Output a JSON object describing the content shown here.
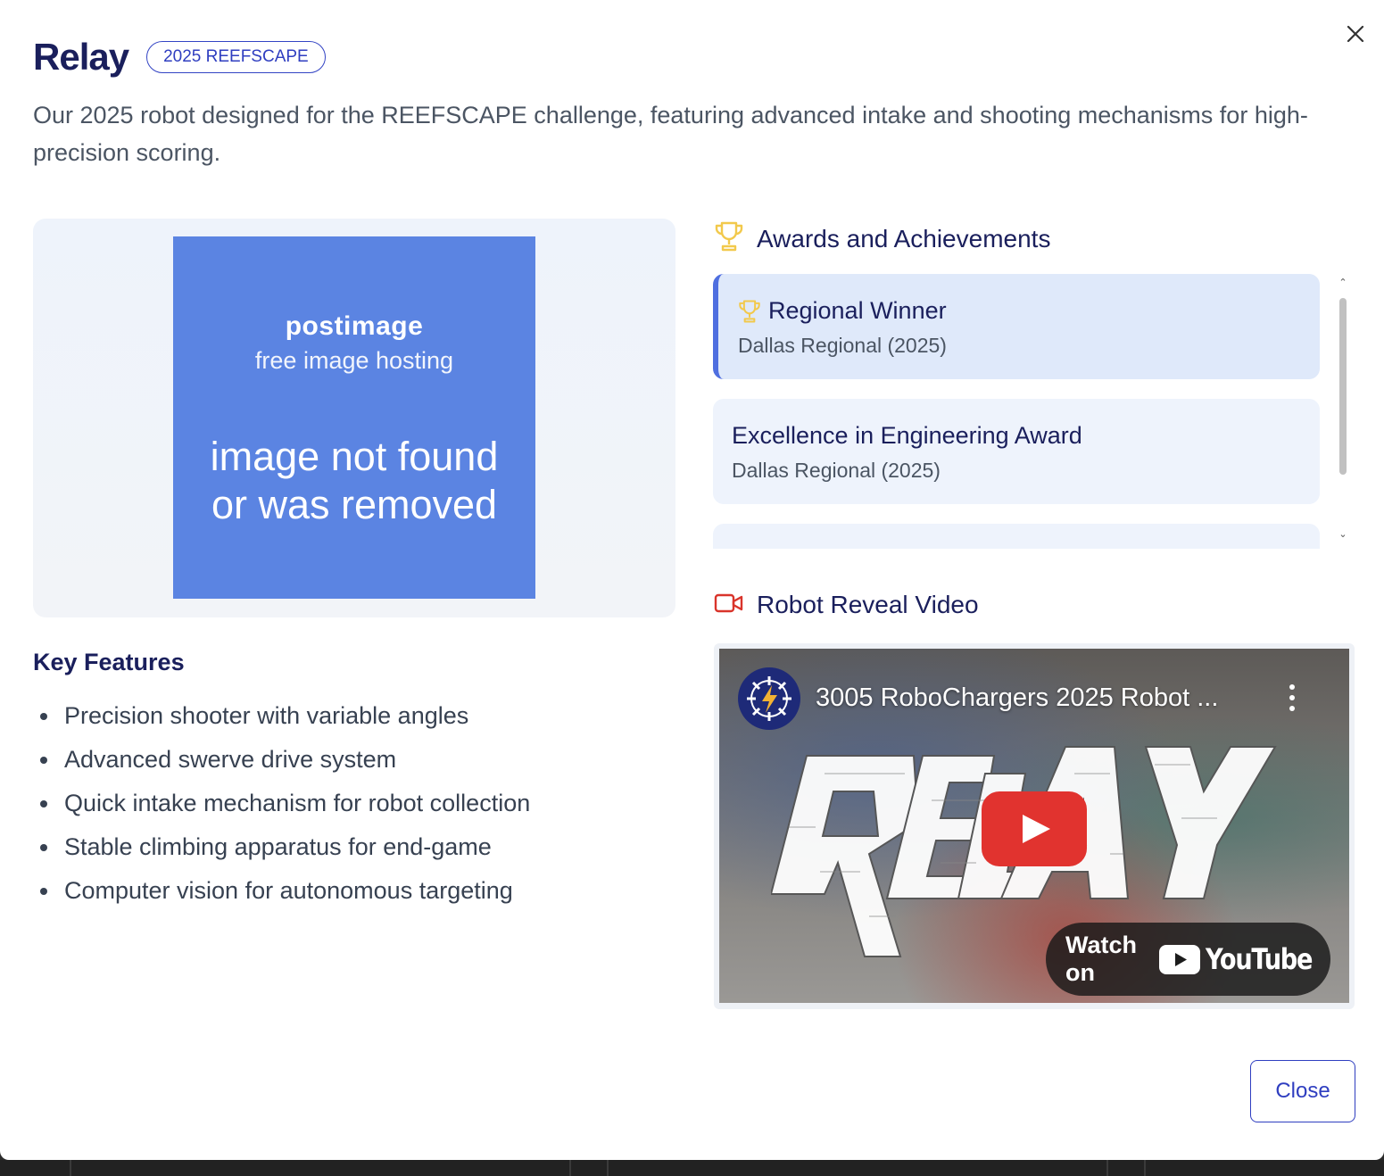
{
  "modal": {
    "title": "Relay",
    "badge": "2025 REEFSCAPE",
    "description": "Our 2025 robot designed for the REEFSCAPE challenge, featuring advanced intake and shooting mechanisms for high-precision scoring.",
    "close_icon": "close-icon",
    "close_button_label": "Close"
  },
  "image_placeholder": {
    "brand": "postimage",
    "subtitle": "free image hosting",
    "message_line1": "image not found",
    "message_line2": "or was removed"
  },
  "features": {
    "title": "Key Features",
    "items": [
      "Precision shooter with variable angles",
      "Advanced swerve drive system",
      "Quick intake mechanism for robot collection",
      "Stable climbing apparatus for end-game",
      "Computer vision for autonomous targeting"
    ]
  },
  "awards": {
    "title": "Awards and Achievements",
    "icon": "trophy-icon",
    "items": [
      {
        "name": "Regional Winner",
        "event": "Dallas Regional (2025)"
      },
      {
        "name": "Excellence in Engineering Award",
        "event": "Dallas Regional (2025)"
      }
    ]
  },
  "video_section": {
    "title": "Robot Reveal Video",
    "icon": "video-camera-icon",
    "video_title": "3005 RoboChargers 2025 Robot ...",
    "watch_on": "Watch on",
    "platform": "YouTube"
  },
  "colors": {
    "heading": "#1a1f5c",
    "accent": "#2f3ec0",
    "trophy": "#f2c94c",
    "video_icon": "#d9342b",
    "youtube_red": "#e1332f",
    "placeholder_bg": "#5b84e2"
  }
}
